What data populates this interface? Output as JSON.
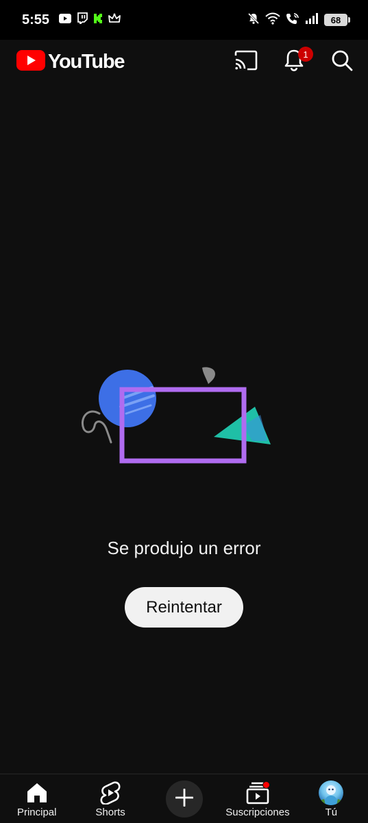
{
  "status_bar": {
    "time": "5:55",
    "battery": "68",
    "left_icons": [
      "youtube-icon",
      "twitch-icon",
      "kick-icon",
      "crown-icon"
    ],
    "right_icons": [
      "mute-icon",
      "wifi-icon",
      "wifi-calling-icon",
      "signal-icon",
      "battery-icon"
    ]
  },
  "header": {
    "logo_text": "YouTube",
    "notification_count": "1",
    "brand_color": "#ff0000"
  },
  "error": {
    "message": "Se produjo un error",
    "retry_label": "Reintentar"
  },
  "bottom_nav": {
    "items": [
      {
        "label": "Principal",
        "icon": "home-icon"
      },
      {
        "label": "Shorts",
        "icon": "shorts-icon"
      },
      {
        "label": "",
        "icon": "create-icon"
      },
      {
        "label": "Suscripciones",
        "icon": "subscriptions-icon"
      },
      {
        "label": "Tú",
        "icon": "avatar"
      }
    ]
  }
}
